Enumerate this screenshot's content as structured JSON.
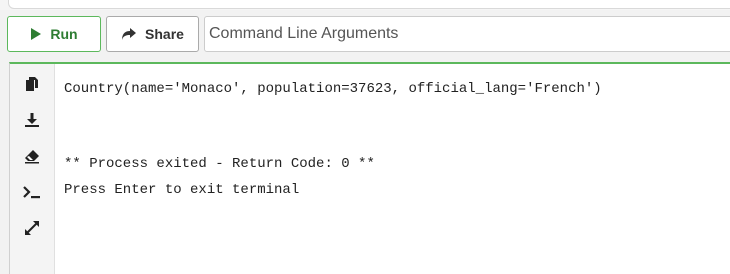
{
  "toolbar": {
    "run_label": "Run",
    "share_label": "Share",
    "args_placeholder": "Command Line Arguments"
  },
  "sidebar": {
    "icons": [
      "copy-icon",
      "download-icon",
      "eraser-icon",
      "terminal-icon",
      "expand-icon"
    ]
  },
  "terminal": {
    "output_line": "Country(name='Monaco', population=37623, official_lang='French')",
    "exit_line": "** Process exited - Return Code: 0 **",
    "prompt_line": "Press Enter to exit terminal"
  },
  "colors": {
    "accent_green": "#5cb85c",
    "run_green": "#2e7d32"
  }
}
